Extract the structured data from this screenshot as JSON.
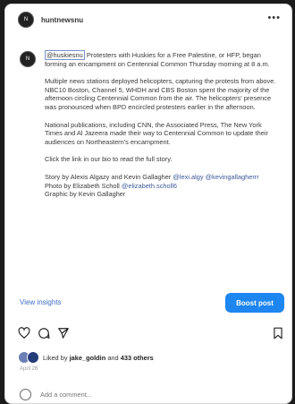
{
  "post": {
    "account": "huntnewsnu",
    "caption": {
      "mention": "@huskiesnu",
      "p1_rest": " Protesters with Huskies for a Free Palestine, or HFP, began forming an encampment on Centennial Common Thursday morning at 8 a.m.",
      "p2": "Multiple news stations deployed helicopters, capturing the protests from above. NBC10 Boston, Channel 5, WHDH and CBS Boston spent the majority of the afternoon circling Centennial Common from the air. The helicopters' presence was pronounced when BPD encircled protesters earlier in the afternoon.",
      "p3": "National publications, including CNN, the Associated Press, The New York Times and Al Jazeera made their way to Centennial Common to update their audiences on Northeastern's encampment.",
      "p4": "Click the link in our bio to read the full story.",
      "credit_story_prefix": "Story by Alexis Algazy and Kevin Gallagher ",
      "credit_story_handles": "@lexi.algy @kevingallagherrr",
      "credit_photo_prefix": "Photo by Elizabeth Scholl ",
      "credit_photo_handle": "@elizabeth.scholl6",
      "credit_graphic": "Graphic by Kevin Gallagher"
    },
    "view_insights": "View insights",
    "boost_button": "Boost post",
    "likes": {
      "prefix": "Liked by ",
      "user": "jake_goldin",
      "middle": " and ",
      "others": "433 others"
    },
    "date": "April 26",
    "comment_placeholder": "Add a comment..."
  },
  "icons": [
    "more-options-icon",
    "heart-icon",
    "comment-icon",
    "share-icon",
    "bookmark-icon"
  ]
}
